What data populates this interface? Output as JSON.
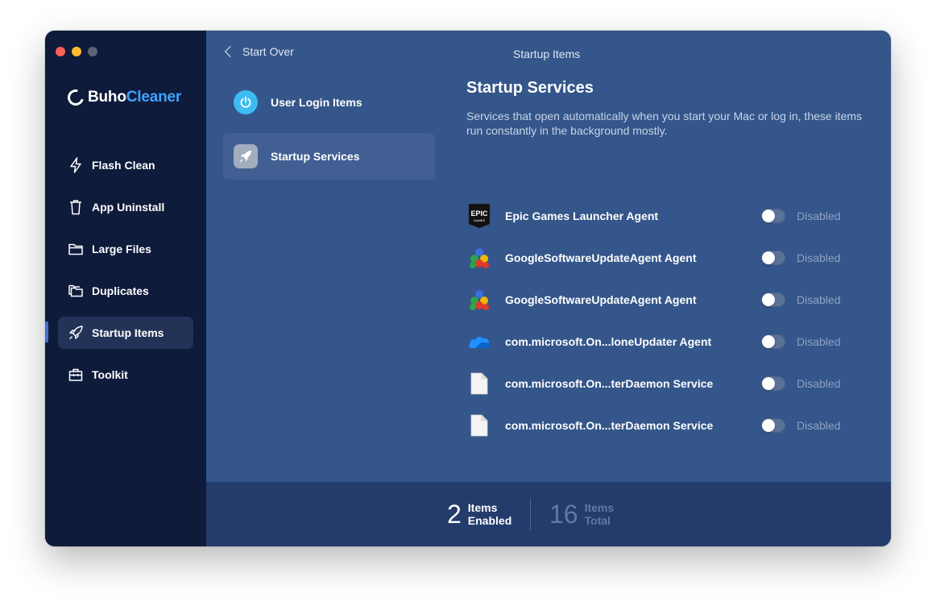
{
  "app": {
    "logo_prefix": "Buho",
    "logo_suffix": "Cleaner",
    "window_title": "Startup Items"
  },
  "sidebar": {
    "items": [
      {
        "label": "Flash Clean",
        "icon": "bolt-icon",
        "active": false
      },
      {
        "label": "App Uninstall",
        "icon": "trash-icon",
        "active": false
      },
      {
        "label": "Large Files",
        "icon": "folder-icon",
        "active": false
      },
      {
        "label": "Duplicates",
        "icon": "folders-icon",
        "active": false
      },
      {
        "label": "Startup Items",
        "icon": "rocket-icon",
        "active": true
      },
      {
        "label": "Toolkit",
        "icon": "toolbox-icon",
        "active": false
      }
    ]
  },
  "header": {
    "back_label": "Start Over"
  },
  "categories": [
    {
      "label": "User Login Items",
      "icon": "power-icon",
      "active": false
    },
    {
      "label": "Startup Services",
      "icon": "rocket-icon",
      "active": true
    }
  ],
  "section": {
    "title": "Startup Services",
    "description": "Services that open automatically when you start your Mac or log in, these items run constantly in the background mostly."
  },
  "services": [
    {
      "name": "Epic Games Launcher Agent",
      "icon": "epic-games-icon",
      "status": "Disabled",
      "enabled": false
    },
    {
      "name": "GoogleSoftwareUpdateAgent Agent",
      "icon": "google-update-icon",
      "status": "Disabled",
      "enabled": false
    },
    {
      "name": "GoogleSoftwareUpdateAgent Agent",
      "icon": "google-update-icon",
      "status": "Disabled",
      "enabled": false
    },
    {
      "name": "com.microsoft.On...loneUpdater Agent",
      "icon": "onedrive-icon",
      "status": "Disabled",
      "enabled": false
    },
    {
      "name": "com.microsoft.On...terDaemon Service",
      "icon": "document-icon",
      "status": "Disabled",
      "enabled": false
    },
    {
      "name": "com.microsoft.On...terDaemon Service",
      "icon": "document-icon",
      "status": "Disabled",
      "enabled": false
    }
  ],
  "footer": {
    "enabled_count": "2",
    "enabled_label_1": "Items",
    "enabled_label_2": "Enabled",
    "total_count": "16",
    "total_label_1": "Items",
    "total_label_2": "Total"
  },
  "colors": {
    "sidebar_bg": "#0e1b3b",
    "main_bg": "#34568a",
    "footer_bg": "#243c6c",
    "accent": "#3ea3ff"
  }
}
